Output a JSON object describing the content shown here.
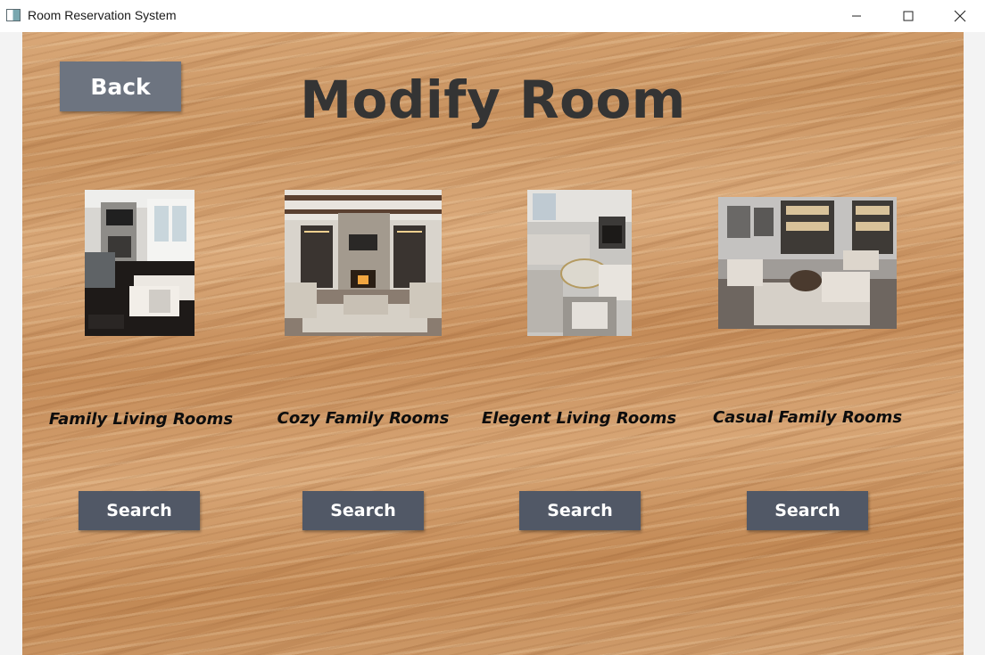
{
  "window": {
    "title": "Room Reservation System"
  },
  "page": {
    "back_label": "Back",
    "title": "Modify Room"
  },
  "rooms": [
    {
      "name": "Family Living Rooms",
      "search_label": "Search"
    },
    {
      "name": "Cozy Family Rooms",
      "search_label": "Search"
    },
    {
      "name": "Elegent Living Rooms",
      "search_label": "Search"
    },
    {
      "name": "Casual Family Rooms",
      "search_label": "Search"
    }
  ],
  "colors": {
    "back_button": "#6d7480",
    "search_button": "#515866",
    "title_text": "#343434",
    "wood": "#d2a070"
  }
}
